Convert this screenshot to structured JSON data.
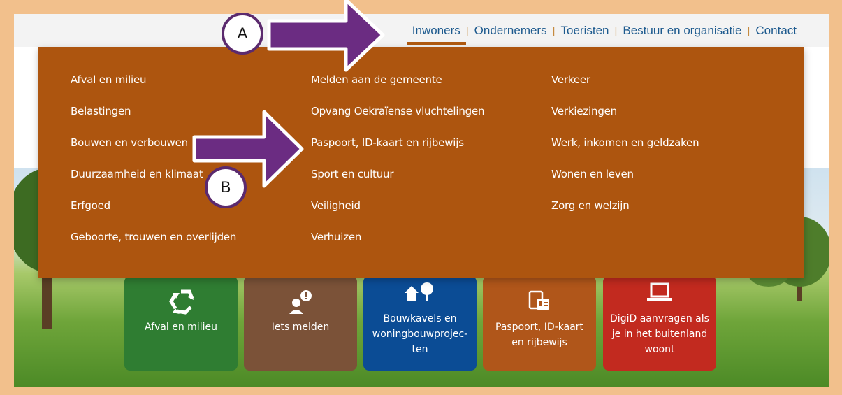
{
  "nav": {
    "items": [
      {
        "label": "Inwoners",
        "active": true
      },
      {
        "label": "Ondernemers"
      },
      {
        "label": "Toeristen"
      },
      {
        "label": "Bestuur en organisatie"
      },
      {
        "label": "Contact"
      }
    ],
    "separator": "|"
  },
  "menu": {
    "col1": [
      "Afval en milieu",
      "Belastingen",
      "Bouwen en verbouwen",
      "Duurzaamheid en klimaat",
      "Erfgoed",
      "Geboorte, trouwen en overlijden"
    ],
    "col2": [
      "Melden aan de gemeente",
      "Opvang Oekraïense vluchtelingen",
      "Paspoort, ID-kaart en rijbewijs",
      "Sport en cultuur",
      "Veiligheid",
      "Verhuizen"
    ],
    "col3": [
      "Verkeer",
      "Verkiezingen",
      "Werk, inkomen en geldzaken",
      "Wonen en leven",
      "Zorg en welzijn"
    ]
  },
  "tiles": [
    {
      "label": "Afval en milieu",
      "icon": "recycle-icon",
      "color": "#2f7d32"
    },
    {
      "label": "Iets melden",
      "icon": "report-person-icon",
      "color": "#7b5238"
    },
    {
      "label": "Bouwkavels en woningbouwprojec-ten",
      "icon": "houses-tree-icon",
      "color": "#0b4c95"
    },
    {
      "label": "Paspoort, ID-kaart en rijbewijs",
      "icon": "id-card-icon",
      "color": "#b0561a"
    },
    {
      "label": "DigiD aanvragen als je in het buitenland woont",
      "icon": "laptop-icon",
      "color": "#c22a1f"
    }
  ],
  "annotations": {
    "a": "A",
    "b": "B"
  },
  "colors": {
    "menu_bg": "#ad550f",
    "nav_text": "#1d5a8e",
    "annotation": "#6b2c82",
    "frame": "#f2c08c"
  }
}
